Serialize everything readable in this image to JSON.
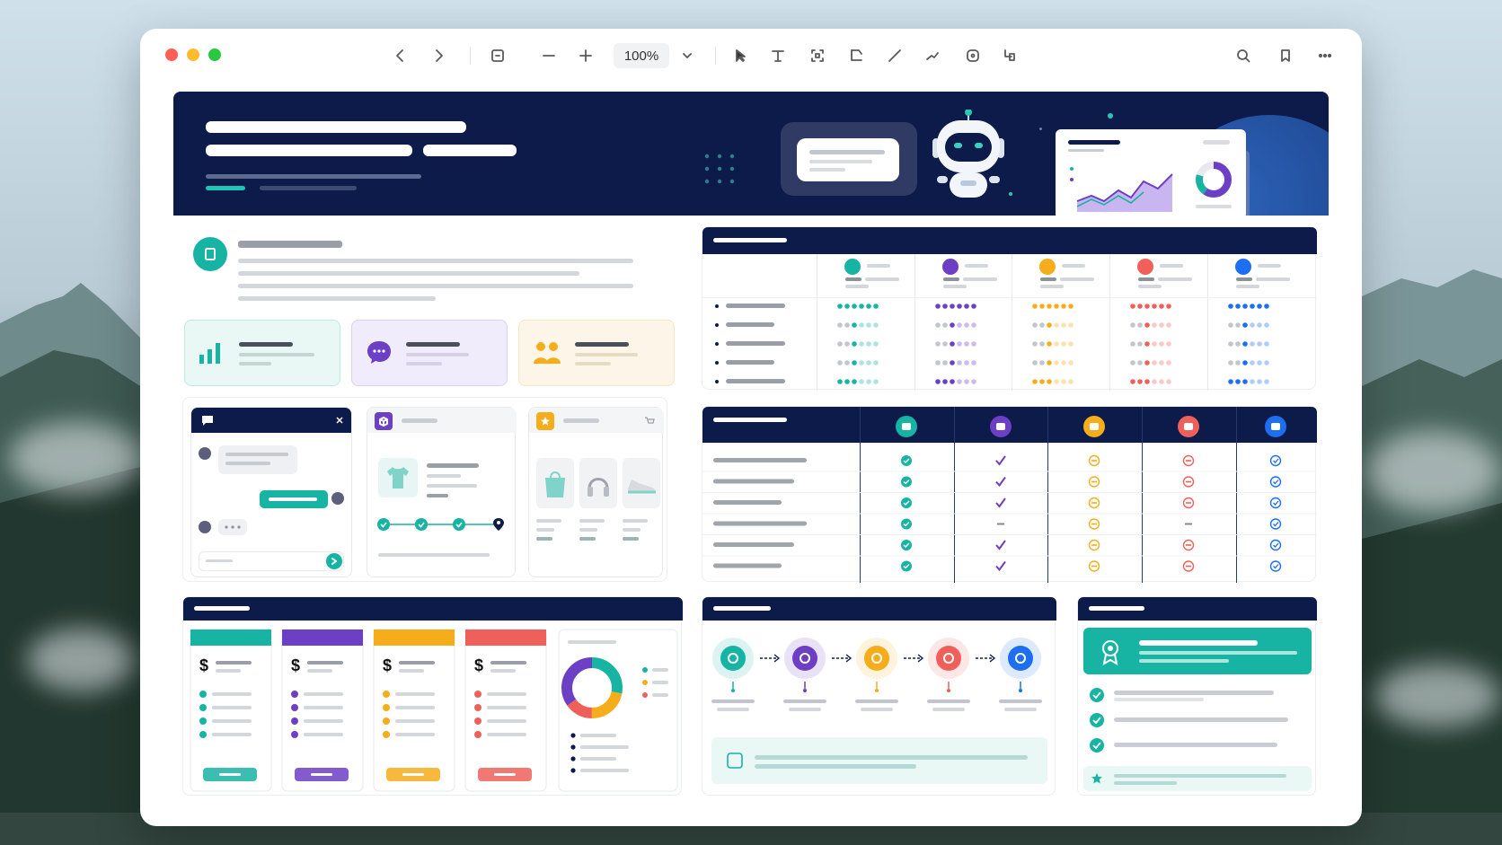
{
  "toolbar": {
    "zoom": "100%",
    "traffic_colors": [
      "#ff5f57",
      "#febc2e",
      "#28c840"
    ],
    "tools": [
      "back-icon",
      "forward-icon",
      "fit-icon",
      "zoom-out-icon",
      "zoom-in-icon",
      "zoom-dropdown-icon",
      "pointer-icon",
      "text-icon",
      "frame-icon",
      "crop-icon",
      "line-icon",
      "connector-icon",
      "shape-icon",
      "link-icon",
      "search-icon",
      "bookmark-icon",
      "more-icon"
    ]
  },
  "palette": {
    "navy": "#0d1b4b",
    "teal": "#17b3a3",
    "purple": "#6c3fc5",
    "orange": "#f5ad1b",
    "red": "#f0605a",
    "blue": "#1e6ff0"
  },
  "feature_cards": [
    "bar-chart-icon",
    "chat-bubble-icon",
    "people-icon"
  ],
  "product_icons": [
    "bag-icon",
    "headphones-icon",
    "sneaker-icon"
  ],
  "pricing": [
    {
      "currency": "$",
      "color": "#17b3a3"
    },
    {
      "currency": "$",
      "color": "#6c3fc5"
    },
    {
      "currency": "$",
      "color": "#f5ad1b"
    },
    {
      "currency": "$",
      "color": "#f0605a"
    }
  ],
  "process_steps": [
    "target-icon",
    "team-icon",
    "megaphone-icon",
    "growth-chart-icon",
    "rocket-icon"
  ],
  "feature_matrix_icons": [
    "robot-icon",
    "team-icon",
    "mail-icon",
    "report-icon",
    "spreadsheet-icon"
  ]
}
